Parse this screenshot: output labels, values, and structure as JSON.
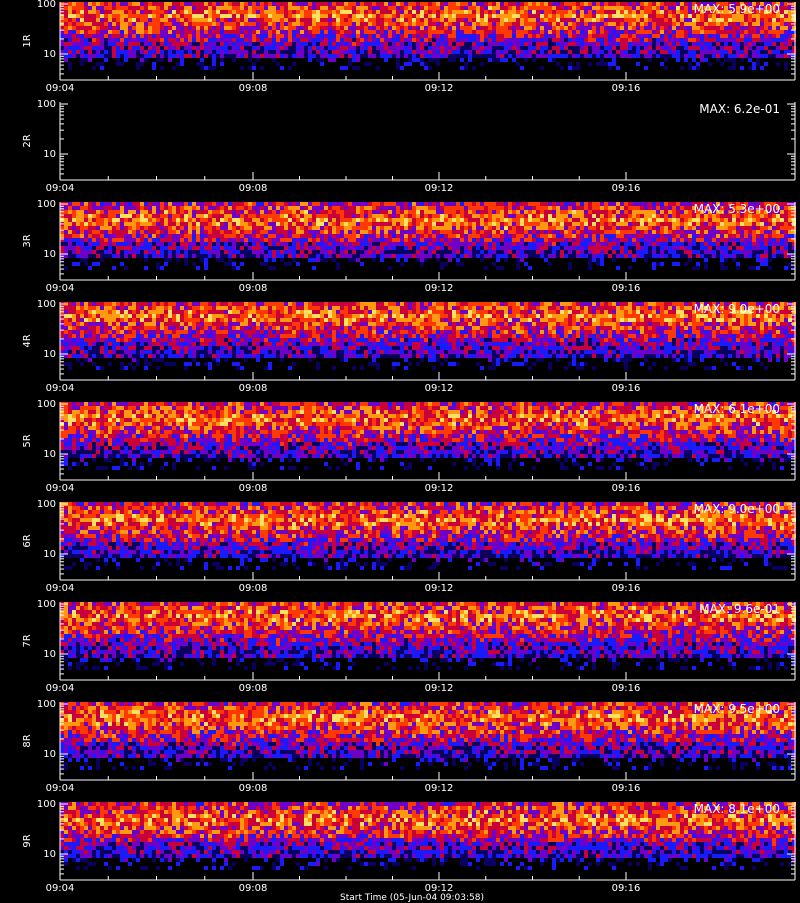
{
  "chart_data": {
    "type": "heatmap",
    "panels": [
      {
        "label": "1R",
        "max_text": "MAX: 5.9e+00",
        "max": 5.9,
        "empty": false
      },
      {
        "label": "2R",
        "max_text": "MAX: 6.2e-01",
        "max": 0.62,
        "empty": true
      },
      {
        "label": "3R",
        "max_text": "MAX: 5.3e+00",
        "max": 5.3,
        "empty": false
      },
      {
        "label": "4R",
        "max_text": "MAX: 9.0e+00",
        "max": 9.0,
        "empty": false
      },
      {
        "label": "5R",
        "max_text": "MAX: 6.1e+00",
        "max": 6.1,
        "empty": false
      },
      {
        "label": "6R",
        "max_text": "MAX: 9.0e+00",
        "max": 9.0,
        "empty": false
      },
      {
        "label": "7R",
        "max_text": "MAX: 9.6e-01",
        "max": 0.96,
        "empty": false
      },
      {
        "label": "8R",
        "max_text": "MAX: 9.5e+00",
        "max": 9.5,
        "empty": false
      },
      {
        "label": "9R",
        "max_text": "MAX: 8.1e+00",
        "max": 8.1,
        "empty": false
      }
    ],
    "x_ticks": [
      "09:04",
      "09:08",
      "09:12",
      "09:16"
    ],
    "y_ticks": [
      "100",
      "10"
    ],
    "yscale": "log",
    "ylim": [
      3,
      110
    ],
    "footer": "Start Time (05-Jun-04 09:03:58)"
  },
  "colors": {
    "background": "#000000",
    "axis": "#ffffff",
    "colormap": [
      "#000000",
      "#0a0060",
      "#1a1aff",
      "#6f00c8",
      "#c8003c",
      "#ff3a00",
      "#ff9a10",
      "#ffe060"
    ]
  }
}
